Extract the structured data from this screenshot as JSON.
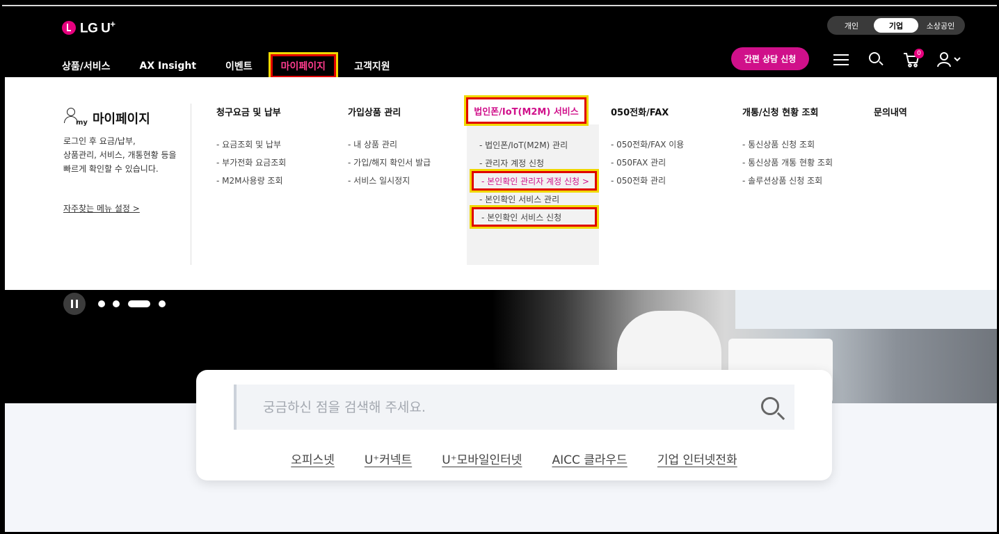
{
  "header": {
    "logo_text": "LG U",
    "logo_sup": "+",
    "segments": [
      "개인",
      "기업",
      "소상공인"
    ],
    "active_segment": "기업",
    "nav": [
      "상품/서비스",
      "AX Insight",
      "이벤트",
      "마이페이지",
      "고객지원"
    ],
    "active_nav": "마이페이지",
    "consult_button": "간편 상담 신청",
    "cart_count": "0",
    "icons": [
      "menu-icon",
      "search-icon",
      "cart-icon",
      "user-icon",
      "chevron-down-icon"
    ]
  },
  "mega": {
    "my": {
      "icon_text": "my",
      "title": "마이페이지",
      "desc_lines": [
        "로그인 후 요금/납부,",
        "상품관리, 서비스, 개통현황 등을",
        "빠르게 확인할 수 있습니다."
      ],
      "fav_link": "자주찾는 메뉴 설정 >"
    },
    "columns": [
      {
        "title": "청구요금 및 납부",
        "items": [
          "요금조회 및 납부",
          "부가전화 요금조회",
          "M2M사용량 조회"
        ]
      },
      {
        "title": "가입상품 관리",
        "items": [
          "내 상품 관리",
          "가입/해지 확인서 발급",
          "서비스 일시정지"
        ]
      },
      {
        "title": "법인폰/IoT(M2M) 서비스",
        "items": [
          "- 법인폰/IoT(M2M) 관리",
          "- 관리자 계정 신청",
          "- 본인확인 관리자 계정 신청  >",
          "- 본인확인 서비스 관리",
          "- 본인확인 서비스 신청"
        ]
      },
      {
        "title": "050전화/FAX",
        "items": [
          "050전화/FAX 이용",
          "050FAX 관리",
          "050전화 관리"
        ]
      },
      {
        "title": "개통/신청 현황 조회",
        "items": [
          "통신상품 신청 조회",
          "통신상품 개통 현황 조회",
          "솔루션상품 신청 조회"
        ]
      },
      {
        "title": "문의내역",
        "items": []
      }
    ]
  },
  "hero": {
    "carousel_slides": 4,
    "active_slide": 3
  },
  "search": {
    "placeholder": "궁금하신 점을 검색해 주세요.",
    "quick_links": [
      "오피스넷",
      "U⁺커넥트",
      "U⁺모바일인터넷",
      "AICC 클라우드",
      "기업 인터넷전화"
    ]
  },
  "colors": {
    "brand_pink": "#d0108a",
    "highlight_red": "#e00000",
    "highlight_yellow": "#f0d800"
  }
}
